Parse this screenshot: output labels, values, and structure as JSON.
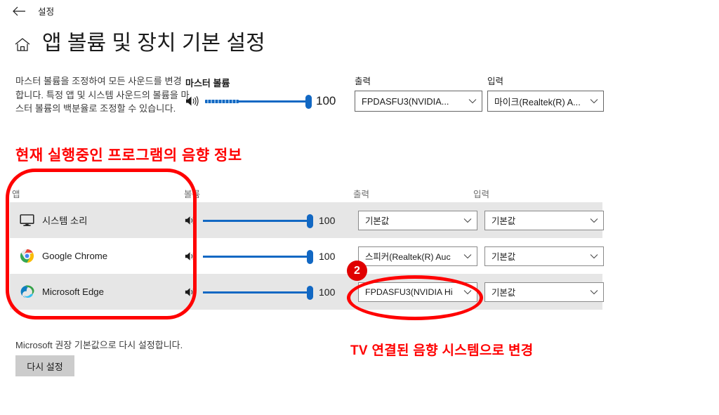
{
  "titlebar": {
    "back_icon": "back-arrow-icon",
    "title": "설정"
  },
  "header": {
    "home_icon": "home-icon",
    "title": "앱 볼륨 및 장치 기본 설정"
  },
  "master": {
    "description": "마스터 볼륨을 조정하여 모든 사운드를 변경합니다. 특정 앱 및 시스템 사운드의 볼륨을 마스터 볼륨의 백분율로 조정할 수 있습니다.",
    "volume_label": "마스터 볼륨",
    "speaker_icon": "speaker-icon",
    "volume_value": "100",
    "output": {
      "label": "출력",
      "value": "FPDASFU3(NVIDIA...",
      "chevron_icon": "chevron-down-icon"
    },
    "input": {
      "label": "입력",
      "value": "마이크(Realtek(R) A...",
      "chevron_icon": "chevron-down-icon"
    }
  },
  "table": {
    "headers": {
      "app": "앱",
      "volume": "볼륨",
      "output": "출력",
      "input": "입력"
    },
    "rows": [
      {
        "icon": "monitor-icon",
        "name": "시스템 소리",
        "volume": "100",
        "output": "기본값",
        "input": "기본값",
        "shaded": true
      },
      {
        "icon": "chrome-icon",
        "name": "Google Chrome",
        "volume": "100",
        "output": "스피커(Realtek(R) Auc",
        "input": "기본값",
        "shaded": false
      },
      {
        "icon": "edge-icon",
        "name": "Microsoft Edge",
        "volume": "100",
        "output": "FPDASFU3(NVIDIA Hi",
        "input": "기본값",
        "shaded": true
      }
    ]
  },
  "reset": {
    "description": "Microsoft 권장 기본값으로 다시 설정합니다.",
    "button_label": "다시 설정"
  },
  "annotations": {
    "top_text": "현재 실행중인 프로그램의 음향 정보",
    "bottom_text": "TV 연결된 음향 시스템으로 변경",
    "step_badge": "2",
    "color": "#ff0000"
  },
  "colors": {
    "accent_blue": "#1268c3",
    "row_shade": "#e6e6e6",
    "annotation_red": "#ff0000",
    "badge_red": "#e00000"
  }
}
